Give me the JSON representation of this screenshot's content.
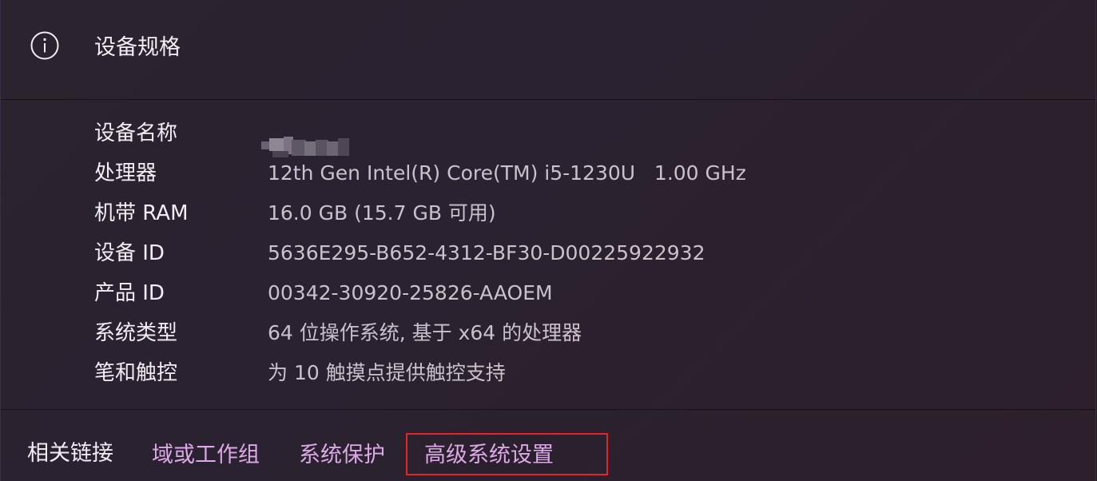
{
  "header": {
    "title": "设备规格",
    "icon": "info-icon"
  },
  "specs": [
    {
      "label": "设备名称",
      "value": ""
    },
    {
      "label": "处理器",
      "value": "12th Gen Intel(R) Core(TM) i5-1230U   1.00 GHz"
    },
    {
      "label": "机带 RAM",
      "value": "16.0 GB (15.7 GB 可用)"
    },
    {
      "label": "设备 ID",
      "value": "5636E295-B652-4312-BF30-D00225922932"
    },
    {
      "label": "产品 ID",
      "value": "00342-30920-25826-AAOEM"
    },
    {
      "label": "系统类型",
      "value": "64 位操作系统, 基于 x64 的处理器"
    },
    {
      "label": "笔和触控",
      "value": "为 10 触摸点提供触控支持"
    }
  ],
  "footer": {
    "label": "相关链接",
    "links": [
      "域或工作组",
      "系统保护",
      "高级系统设置"
    ]
  },
  "colors": {
    "link": "#dca9e6",
    "highlight": "#e2242d"
  }
}
